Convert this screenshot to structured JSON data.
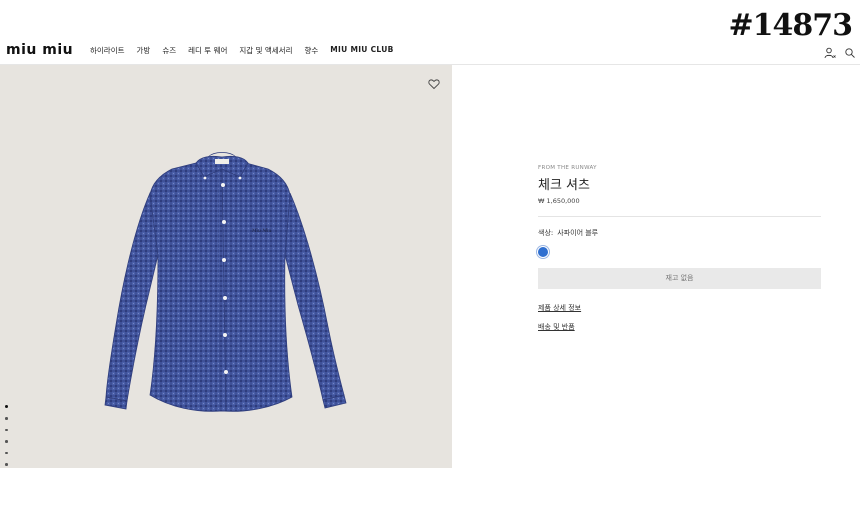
{
  "watermark": "#14873",
  "header": {
    "logo": "MIU MIU",
    "nav": [
      "하이라이트",
      "가방",
      "슈즈",
      "레디 투 웨어",
      "지갑 및 액세서리",
      "향수",
      "MIU MIU CLUB"
    ],
    "icons": [
      "account-icon",
      "search-icon"
    ]
  },
  "gallery": {
    "image": "blue-check-shirt",
    "favorite_icon": "heart-icon",
    "shirt_tag": "Miu Miu",
    "active_image": 1,
    "image_count": 6
  },
  "product": {
    "eyebrow": "FROM THE RUNWAY",
    "name": "체크 셔츠",
    "price": "₩ 1,650,000",
    "color_label": "색상:",
    "color_value": "사파이어 블루",
    "swatch_color": "#2f6fd0",
    "sold_out_button": "재고 없음",
    "details_link": "제품 상세 정보",
    "shipping_link": "배송 및 반품"
  }
}
